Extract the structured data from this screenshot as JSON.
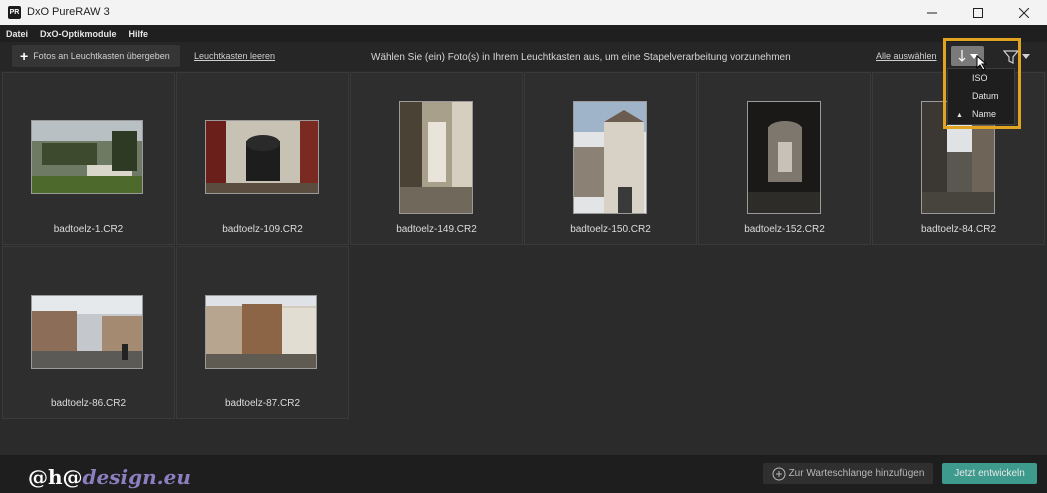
{
  "window": {
    "title": "DxO PureRAW 3",
    "icon_text": "PR"
  },
  "menu": [
    "Datei",
    "DxO-Optikmodule",
    "Hilfe"
  ],
  "toolbar": {
    "transfer_label": "Fotos an Leuchtkasten übergeben",
    "clear_label": "Leuchtkasten leeren",
    "hint": "Wählen Sie (ein) Foto(s) in Ihrem Leuchtkasten aus, um eine Stapelverarbeitung vorzunehmen",
    "select_all_label": "Alle auswählen",
    "sort_icon": "sort-icon",
    "filter_icon": "filter-icon"
  },
  "sort_menu": {
    "items": [
      "ISO",
      "Datum",
      "Name"
    ],
    "selected": "Name"
  },
  "photos": [
    "badtoelz-1.CR2",
    "badtoelz-109.CR2",
    "badtoelz-149.CR2",
    "badtoelz-150.CR2",
    "badtoelz-152.CR2",
    "badtoelz-84.CR2",
    "badtoelz-86.CR2",
    "badtoelz-87.CR2"
  ],
  "bottom": {
    "watermark_part1": "@h@",
    "watermark_part2": "design.eu",
    "queue_label": "Zur Warteschlange hinzufügen",
    "develop_label": "Jetzt entwickeln"
  },
  "colors": {
    "accent": "#3d9a8c",
    "highlight": "#e0a421"
  }
}
